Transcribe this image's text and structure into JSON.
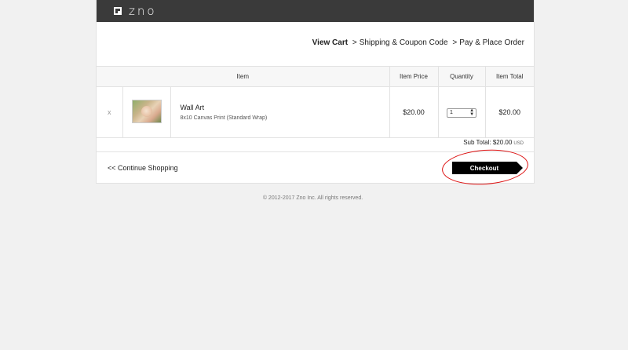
{
  "header": {
    "logo_text": "zno",
    "logo_icon": "zno-logo-icon"
  },
  "steps": {
    "current": "View Cart",
    "separator": ">",
    "step2": "Shipping & Coupon Code",
    "step3": "Pay & Place Order"
  },
  "table": {
    "headers": {
      "item": "Item",
      "price": "Item Price",
      "quantity": "Quantity",
      "total": "Item Total"
    },
    "rows": [
      {
        "remove": "x",
        "name": "Wall Art",
        "description": "8x10 Canvas Print (Standard Wrap)",
        "price": "$20.00",
        "quantity": "1",
        "total": "$20.00"
      }
    ]
  },
  "subtotal": {
    "label": "Sub Total:",
    "value": "$20.00",
    "currency": "USD"
  },
  "actions": {
    "continue": "<< Continue Shopping",
    "checkout": "Checkout"
  },
  "footer": {
    "copyright": "© 2012-2017 Zno Inc. All rights reserved."
  },
  "colors": {
    "topbar": "#3a3a3a",
    "checkout": "#000000",
    "highlight_ring": "#dd1111"
  }
}
